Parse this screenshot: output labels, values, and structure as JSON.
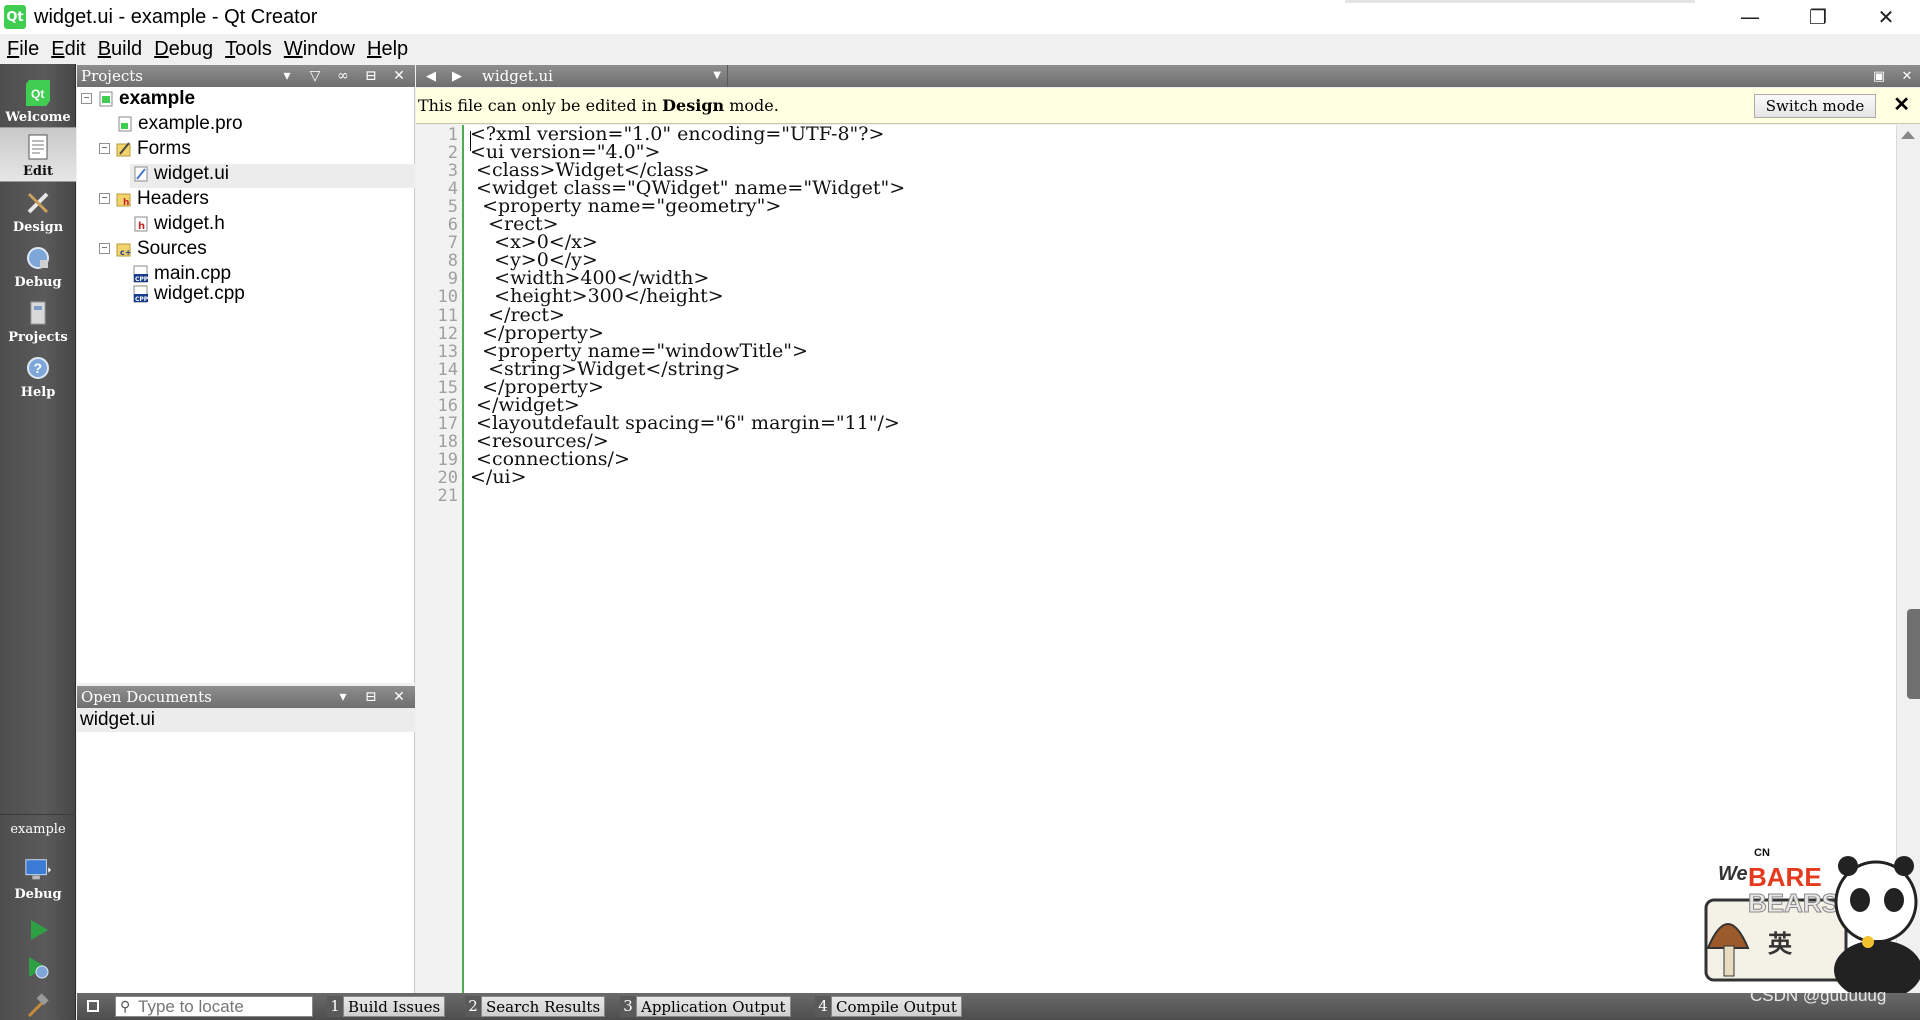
{
  "window": {
    "title": "widget.ui - example - Qt Creator",
    "app_icon_text": "Qt",
    "controls": [
      "minimize",
      "restore",
      "close"
    ]
  },
  "menubar": {
    "items": [
      "File",
      "Edit",
      "Build",
      "Debug",
      "Tools",
      "Window",
      "Help"
    ]
  },
  "modebar": {
    "modes": [
      {
        "label": "Welcome",
        "icon": "qt-logo-icon"
      },
      {
        "label": "Edit",
        "icon": "edit-document-icon",
        "active": true
      },
      {
        "label": "Design",
        "icon": "design-pencil-icon"
      },
      {
        "label": "Debug",
        "icon": "debug-bug-icon"
      },
      {
        "label": "Projects",
        "icon": "projects-wrench-icon"
      },
      {
        "label": "Help",
        "icon": "help-question-icon"
      }
    ],
    "kit": {
      "project": "example",
      "config": "Debug",
      "icon": "monitor-icon"
    },
    "actions": [
      "run-icon",
      "debug-run-icon",
      "build-hammer-icon"
    ]
  },
  "projects_pane": {
    "title": "Projects",
    "tree": [
      {
        "label": "example",
        "level": 0,
        "expander": "−",
        "bold": true,
        "icon": "qt-project-icon"
      },
      {
        "label": "example.pro",
        "level": 1,
        "icon": "pro-file-icon"
      },
      {
        "label": "Forms",
        "level": 1,
        "expander": "−",
        "icon": "forms-folder-icon"
      },
      {
        "label": "widget.ui",
        "level": 2,
        "icon": "ui-file-icon",
        "selected": true
      },
      {
        "label": "Headers",
        "level": 1,
        "expander": "−",
        "icon": "headers-folder-icon"
      },
      {
        "label": "widget.h",
        "level": 2,
        "icon": "header-file-icon"
      },
      {
        "label": "Sources",
        "level": 1,
        "expander": "−",
        "icon": "sources-folder-icon"
      },
      {
        "label": "main.cpp",
        "level": 2,
        "icon": "cpp-file-icon"
      },
      {
        "label": "widget.cpp",
        "level": 2,
        "icon": "cpp-file-icon"
      }
    ]
  },
  "open_documents": {
    "title": "Open Documents",
    "items": [
      "widget.ui"
    ]
  },
  "editor": {
    "current_file": "widget.ui",
    "info_bar": {
      "text_before": "This file can only be edited in ",
      "text_bold": "Design",
      "text_after": " mode.",
      "switch_button": "Switch mode",
      "close": "✕"
    },
    "lines": [
      "<?xml version=\"1.0\" encoding=\"UTF-8\"?>",
      "<ui version=\"4.0\">",
      " <class>Widget</class>",
      " <widget class=\"QWidget\" name=\"Widget\">",
      "  <property name=\"geometry\">",
      "   <rect>",
      "    <x>0</x>",
      "    <y>0</y>",
      "    <width>400</width>",
      "    <height>300</height>",
      "   </rect>",
      "  </property>",
      "  <property name=\"windowTitle\">",
      "   <string>Widget</string>",
      "  </property>",
      " </widget>",
      " <layoutdefault spacing=\"6\" margin=\"11\"/>",
      " <resources/>",
      " <connections/>",
      "</ui>",
      ""
    ]
  },
  "statusbar": {
    "locator_placeholder": "Type to locate",
    "output_tabs": [
      {
        "num": "1",
        "label": "Build Issues"
      },
      {
        "num": "2",
        "label": "Search Results"
      },
      {
        "num": "3",
        "label": "Application Output"
      },
      {
        "num": "4",
        "label": "Compile Output"
      }
    ]
  },
  "watermark": {
    "text": "CSDN @guuuuug",
    "sticker_text": "We BARE BEARS",
    "sticker_badge": "CN",
    "sticker_glyph": "英"
  },
  "colors": {
    "modebar_bg": "#555555",
    "pane_header": "#7f7f7f",
    "info_bar_bg": "#ffffe1",
    "gutter_marker": "#4cad4c",
    "run_green": "#2ea043"
  }
}
